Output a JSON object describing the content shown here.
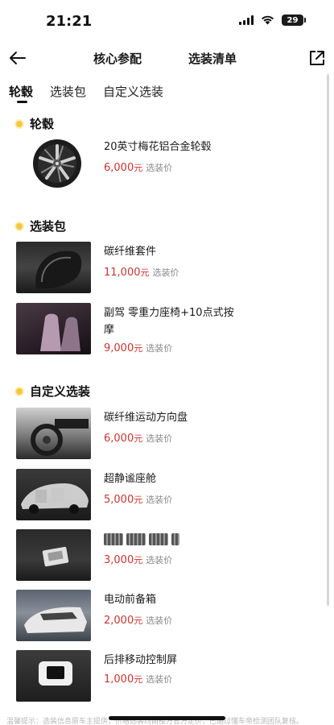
{
  "status_bar": {
    "time": "21:21",
    "battery": "29"
  },
  "header": {
    "tab_specs": "核心参配",
    "tab_options": "选装清单"
  },
  "sub_tabs": [
    "轮毂",
    "选装包",
    "自定义选装"
  ],
  "price_unit": "元",
  "price_tag": "选装价",
  "sections": {
    "wheels": {
      "title": "轮毂",
      "items": [
        {
          "name": "20英寸梅花铝合金轮毂",
          "price": "6,000"
        }
      ]
    },
    "packages": {
      "title": "选装包",
      "items": [
        {
          "name": "碳纤维套件",
          "price": "11,000"
        },
        {
          "name": "副驾 零重力座椅+10点式按摩",
          "price": "9,000"
        }
      ]
    },
    "custom": {
      "title": "自定义选装",
      "items": [
        {
          "name": "碳纤维运动方向盘",
          "price": "6,000"
        },
        {
          "name": "超静谧座舱",
          "price": "5,000"
        },
        {
          "name": "",
          "price": "3,000"
        },
        {
          "name": "电动前备箱",
          "price": "2,000"
        },
        {
          "name": "后排移动控制屏",
          "price": "1,000"
        }
      ]
    }
  },
  "footer_note": "温馨提示：选装信息原车主提供，价格选装均由楼方官方定价，已通过懂车帝检测团队复核。",
  "colors": {
    "price": "#c8352f",
    "section_dot": "#f5c842",
    "text": "#1a1a1a"
  }
}
